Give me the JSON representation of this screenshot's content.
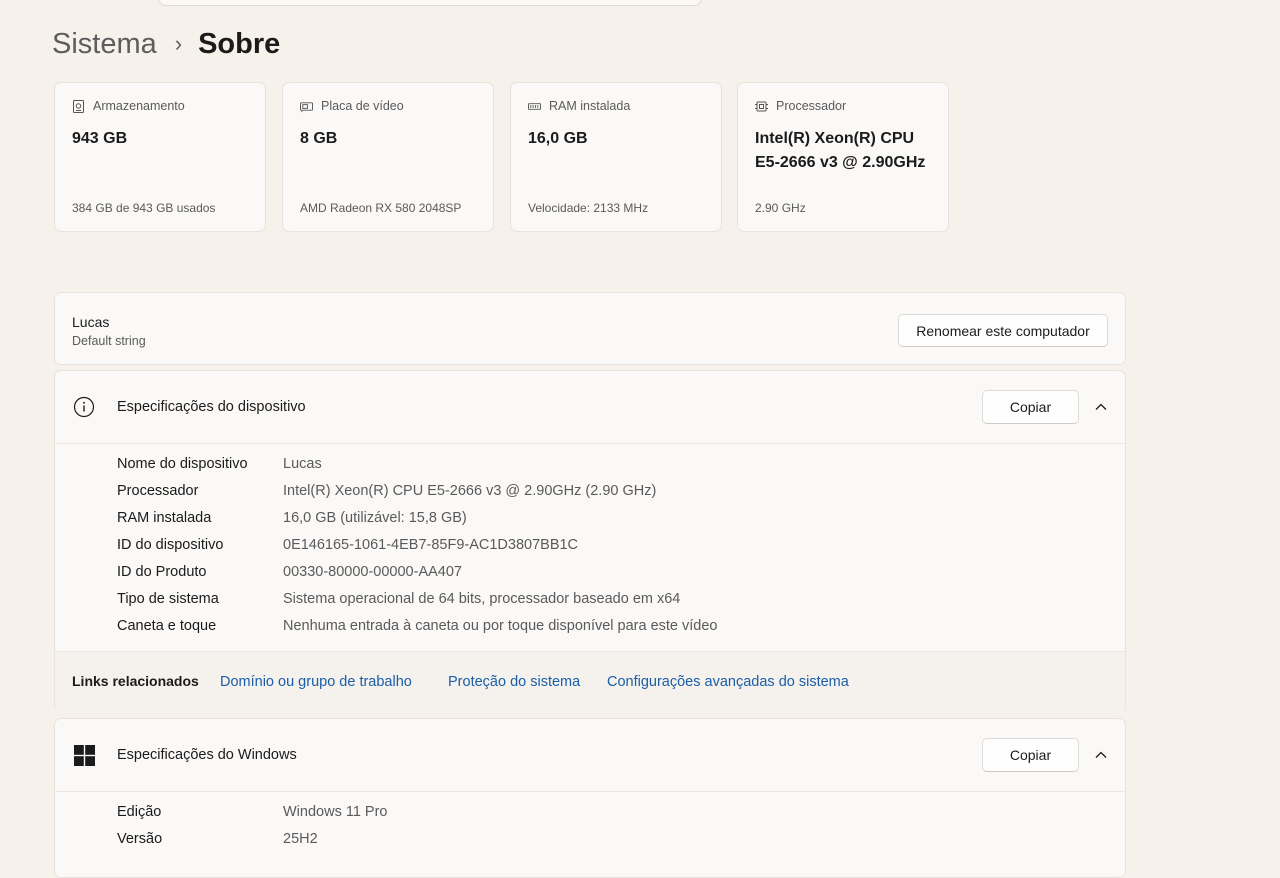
{
  "breadcrumb": {
    "parent": "Sistema",
    "separator": "›",
    "current": "Sobre"
  },
  "tiles": [
    {
      "icon": "storage-icon",
      "label": "Armazenamento",
      "value": "943 GB",
      "sub": "384 GB de 943 GB usados"
    },
    {
      "icon": "gpu-icon",
      "label": "Placa de vídeo",
      "value": "8 GB",
      "sub": "AMD Radeon RX 580 2048SP"
    },
    {
      "icon": "ram-icon",
      "label": "RAM instalada",
      "value": "16,0 GB",
      "sub": "Velocidade: 2133 MHz"
    },
    {
      "icon": "cpu-icon",
      "label": "Processador",
      "value": "Intel(R) Xeon(R) CPU E5-2666 v3 @ 2.90GHz",
      "sub": "2.90 GHz"
    }
  ],
  "computer": {
    "name": "Lucas",
    "model": "Default string",
    "rename_label": "Renomear este computador"
  },
  "device_specs": {
    "title": "Especificações do dispositivo",
    "copy_label": "Copiar",
    "rows": [
      {
        "label": "Nome do dispositivo",
        "value": "Lucas"
      },
      {
        "label": "Processador",
        "value": "Intel(R) Xeon(R) CPU E5-2666 v3 @ 2.90GHz (2.90 GHz)"
      },
      {
        "label": "RAM instalada",
        "value": "16,0 GB (utilizável: 15,8 GB)"
      },
      {
        "label": "ID do dispositivo",
        "value": "0E146165-1061-4EB7-85F9-AC1D3807BB1C"
      },
      {
        "label": "ID do Produto",
        "value": "00330-80000-00000-AA407"
      },
      {
        "label": "Tipo de sistema",
        "value": "Sistema operacional de 64 bits, processador baseado em x64"
      },
      {
        "label": "Caneta e toque",
        "value": "Nenhuma entrada à caneta ou por toque disponível para este vídeo"
      }
    ],
    "links_label": "Links relacionados",
    "links": [
      "Domínio ou grupo de trabalho",
      "Proteção do sistema",
      "Configurações avançadas do sistema"
    ]
  },
  "windows_specs": {
    "title": "Especificações do Windows",
    "copy_label": "Copiar",
    "rows": [
      {
        "label": "Edição",
        "value": "Windows 11 Pro"
      },
      {
        "label": "Versão",
        "value": "25H2"
      }
    ]
  },
  "colors": {
    "background": "#f7f1ec",
    "card": "#fbf9f7",
    "link": "#1a5ea8",
    "text": "#1b1b1b",
    "secondary_text": "#5a5a5a"
  }
}
